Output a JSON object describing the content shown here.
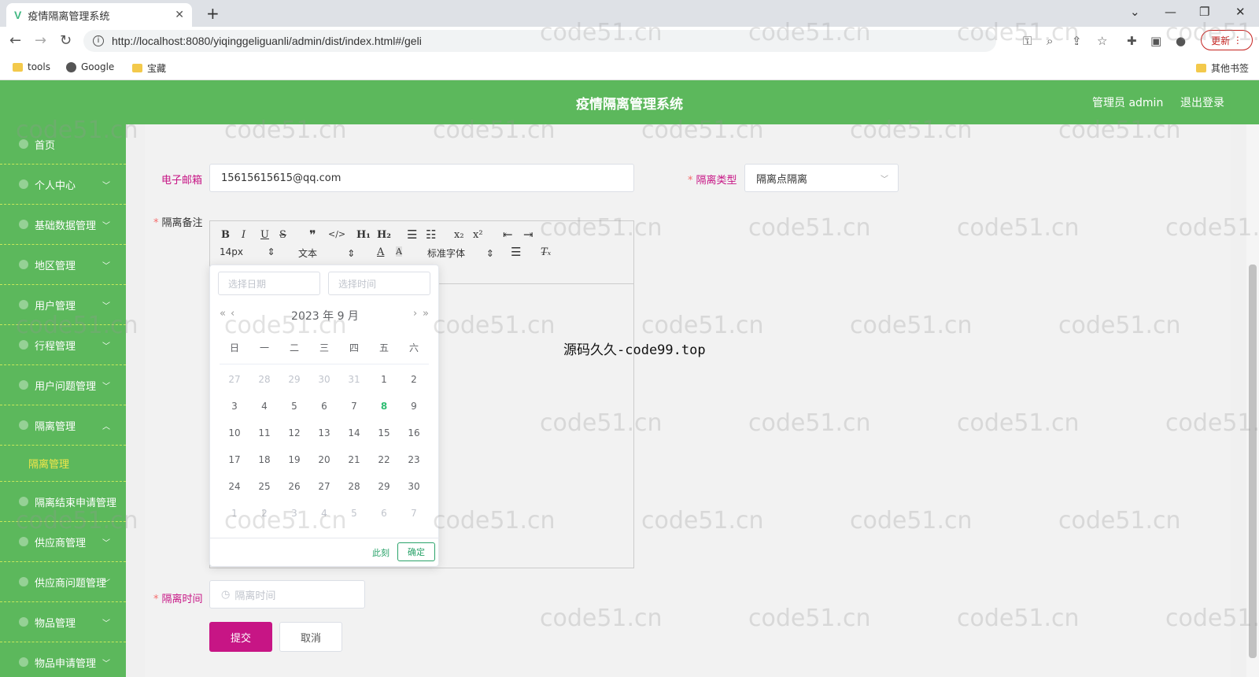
{
  "browser": {
    "tab_title": "疫情隔离管理系统",
    "tab_close": "✕",
    "new_tab": "+",
    "url": "http://localhost:8080/yiqinggeliguanli/admin/dist/index.html#/geli",
    "update_label": "更新",
    "bookmarks": [
      "tools",
      "Google",
      "宝藏"
    ],
    "other_bookmarks": "其他书签"
  },
  "header": {
    "title": "疫情隔离管理系统",
    "admin_label": "管理员 admin",
    "logout_label": "退出登录"
  },
  "sidebar": {
    "items": [
      {
        "label": "首页"
      },
      {
        "label": "个人中心"
      },
      {
        "label": "基础数据管理"
      },
      {
        "label": "地区管理"
      },
      {
        "label": "用户管理"
      },
      {
        "label": "行程管理"
      },
      {
        "label": "用户问题管理"
      },
      {
        "label": "隔离管理"
      },
      {
        "label": "隔离管理"
      },
      {
        "label": "隔离结束申请管理"
      },
      {
        "label": "供应商管理"
      },
      {
        "label": "供应商问题管理"
      },
      {
        "label": "物品管理"
      },
      {
        "label": "物品申请管理"
      }
    ]
  },
  "form": {
    "email_label": "电子邮箱",
    "email_value": "15615615615@qq.com",
    "type_label": "隔离类型",
    "type_value": "隔离点隔离",
    "remark_label": "隔离备注",
    "time_label": "隔离时间",
    "time_placeholder": "隔离时间",
    "submit_label": "提交",
    "cancel_label": "取消"
  },
  "editor": {
    "font_size": "14px",
    "paragraph": "文本",
    "font_family": "标准字体",
    "content_text": "源码久久-code99.top"
  },
  "datepicker": {
    "date_placeholder": "选择日期",
    "time_placeholder": "选择时间",
    "year_month": "2023 年  9 月",
    "weekdays": [
      "日",
      "一",
      "二",
      "三",
      "四",
      "五",
      "六"
    ],
    "weeks": [
      [
        "27",
        "28",
        "29",
        "30",
        "31",
        "1",
        "2"
      ],
      [
        "3",
        "4",
        "5",
        "6",
        "7",
        "8",
        "9"
      ],
      [
        "10",
        "11",
        "12",
        "13",
        "14",
        "15",
        "16"
      ],
      [
        "17",
        "18",
        "19",
        "20",
        "21",
        "22",
        "23"
      ],
      [
        "24",
        "25",
        "26",
        "27",
        "28",
        "29",
        "30"
      ],
      [
        "1",
        "2",
        "3",
        "4",
        "5",
        "6",
        "7"
      ]
    ],
    "today": "8",
    "now_label": "此刻",
    "ok_label": "确定"
  },
  "watermark": "code51.cn",
  "colors": {
    "header_green": "#5cb85c",
    "primary_pink": "#c71585",
    "submenu_yellow": "#f2e64b"
  }
}
